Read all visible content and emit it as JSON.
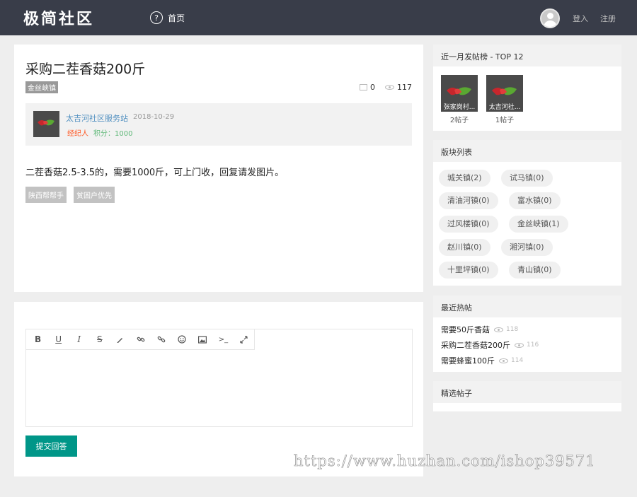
{
  "header": {
    "logo": "极简社区",
    "nav_home": "首页",
    "login": "登入",
    "register": "注册"
  },
  "post": {
    "title": "采购二茬香菇200斤",
    "category_tag": "金丝峡镇",
    "comments": "0",
    "views": "117",
    "author": {
      "name": "太吉河社区服务站",
      "date": "2018-10-29",
      "role": "经纪人",
      "points": "积分：1000"
    },
    "body": "二茬香菇2.5-3.5的，需要1000斤，可上门收，回复请发图片。",
    "tags": [
      "陕西帮帮手",
      "贫困户优先"
    ]
  },
  "reply": {
    "toolbar_icons": [
      "bold-icon",
      "underline-icon",
      "italic-icon",
      "strikethrough-icon",
      "pen-icon",
      "link-icon",
      "unlink-icon",
      "emoji-icon",
      "image-icon",
      "code-icon",
      "fullscreen-icon"
    ],
    "submit_label": "提交回答"
  },
  "sidebar": {
    "top_posters": {
      "title": "近一月发帖榜 - TOP 12",
      "users": [
        {
          "name": "张家岗村...",
          "count": "2帖子"
        },
        {
          "name": "太吉河社...",
          "count": "1帖子"
        }
      ]
    },
    "boards": {
      "title": "版块列表",
      "items": [
        "城关镇(2)",
        "试马镇(0)",
        "清油河镇(0)",
        "富水镇(0)",
        "过风楼镇(0)",
        "金丝峡镇(1)",
        "赵川镇(0)",
        "湘河镇(0)",
        "十里坪镇(0)",
        "青山镇(0)"
      ]
    },
    "hot": {
      "title": "最近热帖",
      "items": [
        {
          "title": "需要50斤香菇",
          "views": "118"
        },
        {
          "title": "采购二茬香菇200斤",
          "views": "116"
        },
        {
          "title": "需要蜂蜜100斤",
          "views": "114"
        }
      ]
    },
    "featured": {
      "title": "精选帖子"
    }
  },
  "watermark": "https://www.huzhan.com/ishop39571",
  "colors": {
    "header_bg": "#393d49",
    "accent": "#009688",
    "link": "#4f8fc0",
    "role": "#ff5722",
    "points": "#5fb878"
  }
}
